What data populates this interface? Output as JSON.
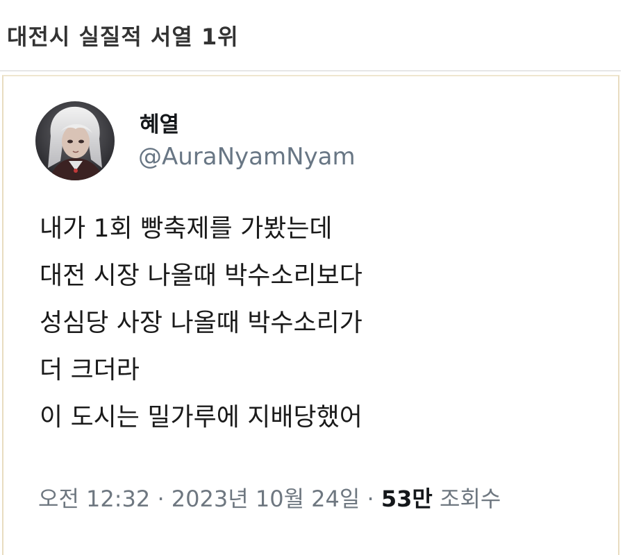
{
  "post": {
    "title": "대전시 실질적 서열 1위"
  },
  "tweet": {
    "display_name": "혜열",
    "handle": "@AuraNyamNyam",
    "avatar_icon": "anime-character-avatar",
    "lines": [
      "내가 1회 빵축제를 가봤는데",
      "대전 시장 나올때 박수소리보다",
      "성심당 사장 나올때 박수소리가",
      "더 크더라",
      "이 도시는 밀가루에 지배당했어"
    ],
    "meta": {
      "time": "오전 12:32",
      "separator": " · ",
      "date": "2023년 10월 24일",
      "views_count": "53만",
      "views_label": "조회수"
    }
  },
  "colors": {
    "card_border": "#e8dcc0",
    "handle_gray": "#687684",
    "text_dark": "#14171a"
  }
}
